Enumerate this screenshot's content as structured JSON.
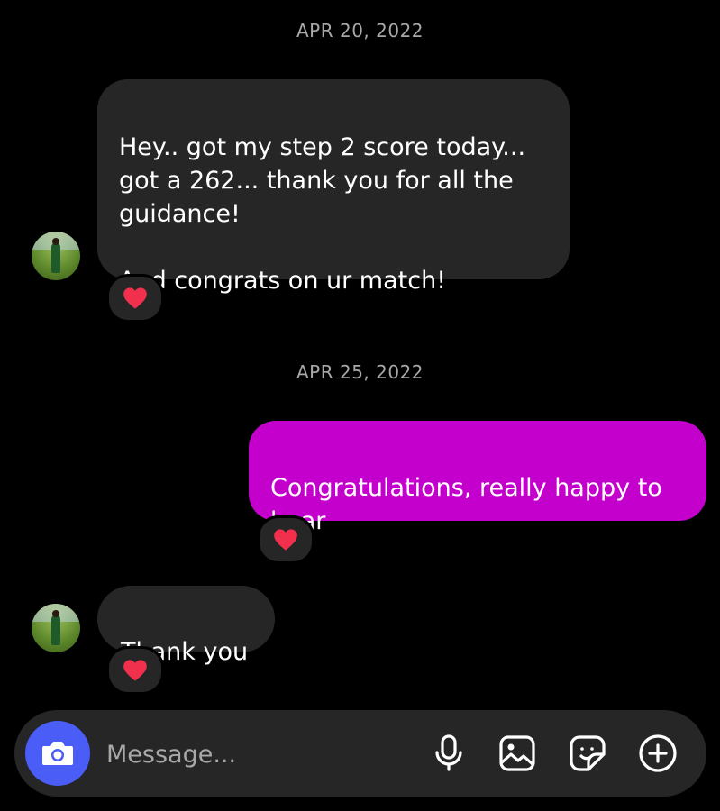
{
  "thread": {
    "date1": "APR 20, 2022",
    "msg1": "Hey.. got my step 2 score today... got a 262... thank you for all the guidance!\n\nAnd congrats on ur match!",
    "date2": "APR 25, 2022",
    "msg2": "Congratulations, really happy to hear",
    "msg3": "Thank you"
  },
  "reactions": {
    "emoji": "heart-icon"
  },
  "composer": {
    "placeholder": "Message...",
    "icons": [
      "camera-icon",
      "microphone-icon",
      "image-icon",
      "sticker-icon",
      "add-icon"
    ]
  },
  "colors": {
    "background": "#000000",
    "incoming_bubble": "#262626",
    "outgoing_bubble": "#c400cc",
    "camera_button": "#4a5df7",
    "heart": "#f0304d"
  }
}
